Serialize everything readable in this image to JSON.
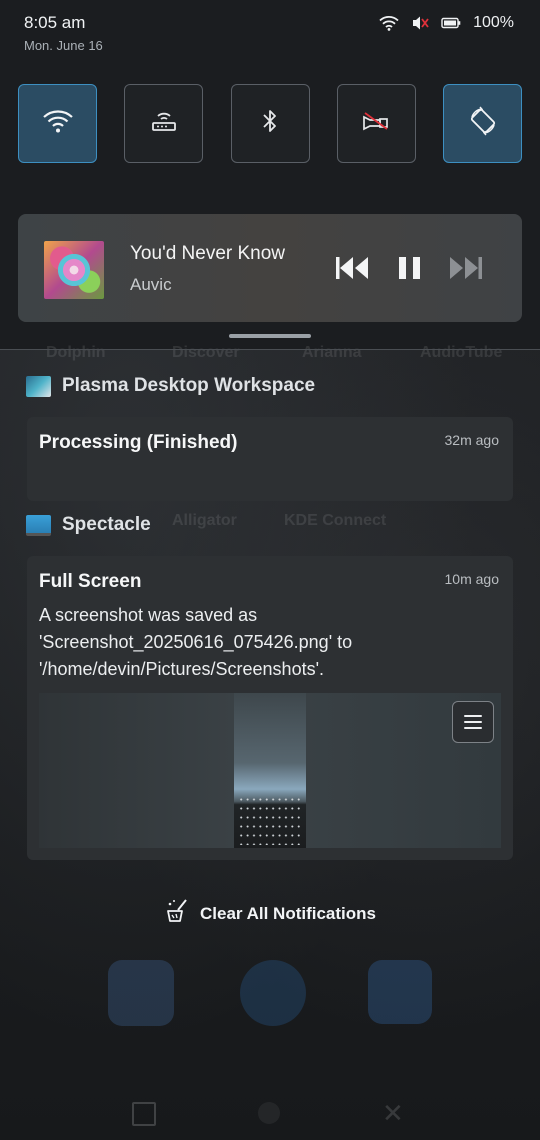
{
  "status_bar": {
    "time": "8:05 am",
    "date": "Mon. June 16",
    "battery_percent": "100%",
    "icons": [
      "wifi-icon",
      "muted-speaker-icon",
      "battery-icon"
    ]
  },
  "quick_settings": {
    "tiles": [
      {
        "name": "wifi",
        "icon": "wifi-icon",
        "active": true
      },
      {
        "name": "hotspot",
        "icon": "router-icon",
        "active": false
      },
      {
        "name": "bluetooth",
        "icon": "bluetooth-icon",
        "active": false
      },
      {
        "name": "flashlight",
        "icon": "flashlight-off-icon",
        "active": false
      },
      {
        "name": "auto-rotate",
        "icon": "rotate-icon",
        "active": true
      }
    ],
    "accent_color": "#3d8fc1"
  },
  "media_player": {
    "title": "You'd Never Know",
    "artist": "Auvic",
    "controls": [
      "skip-previous-icon",
      "pause-icon",
      "skip-next-icon"
    ],
    "next_enabled": false
  },
  "background_labels": {
    "row1": [
      "Dolphin",
      "Discover",
      "Arianna",
      "AudioTube"
    ],
    "row2": [
      "Alligator",
      "KDE Connect"
    ]
  },
  "notifications": [
    {
      "app": "Plasma Desktop Workspace",
      "title": "Processing (Finished)",
      "time": "32m ago"
    },
    {
      "app": "Spectacle",
      "title": "Full Screen",
      "time": "10m ago",
      "body": "A screenshot was saved as 'Screenshot_20250616_075426.png' to '/home/devin/Pictures/Screenshots'."
    }
  ],
  "clear_all_label": "Clear All Notifications"
}
